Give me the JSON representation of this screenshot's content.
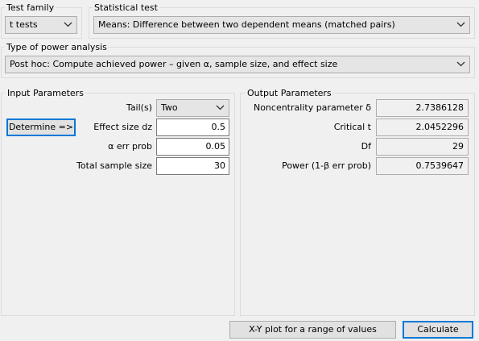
{
  "test_family": {
    "label": "Test family",
    "value": "t tests"
  },
  "statistical_test": {
    "label": "Statistical test",
    "value": "Means: Difference between two dependent means (matched pairs)"
  },
  "power_analysis": {
    "label": "Type of power analysis",
    "value": "Post hoc: Compute achieved power – given α, sample size, and effect size"
  },
  "input": {
    "title": "Input Parameters",
    "determine_label": "Determine =>",
    "tails_label": "Tail(s)",
    "tails_value": "Two",
    "effect_size_label": "Effect size dz",
    "effect_size_value": "0.5",
    "alpha_label": "α err prob",
    "alpha_value": "0.05",
    "sample_size_label": "Total sample size",
    "sample_size_value": "30"
  },
  "output": {
    "title": "Output Parameters",
    "rows": [
      {
        "label": "Noncentrality parameter δ",
        "value": "2.7386128"
      },
      {
        "label": "Critical t",
        "value": "2.0452296"
      },
      {
        "label": "Df",
        "value": "29"
      },
      {
        "label": "Power (1-β err prob)",
        "value": "0.7539647"
      }
    ]
  },
  "buttons": {
    "xy_plot": "X-Y plot for a range of values",
    "calculate": "Calculate"
  },
  "icons": {
    "dropdown": "chevron-down-icon"
  }
}
